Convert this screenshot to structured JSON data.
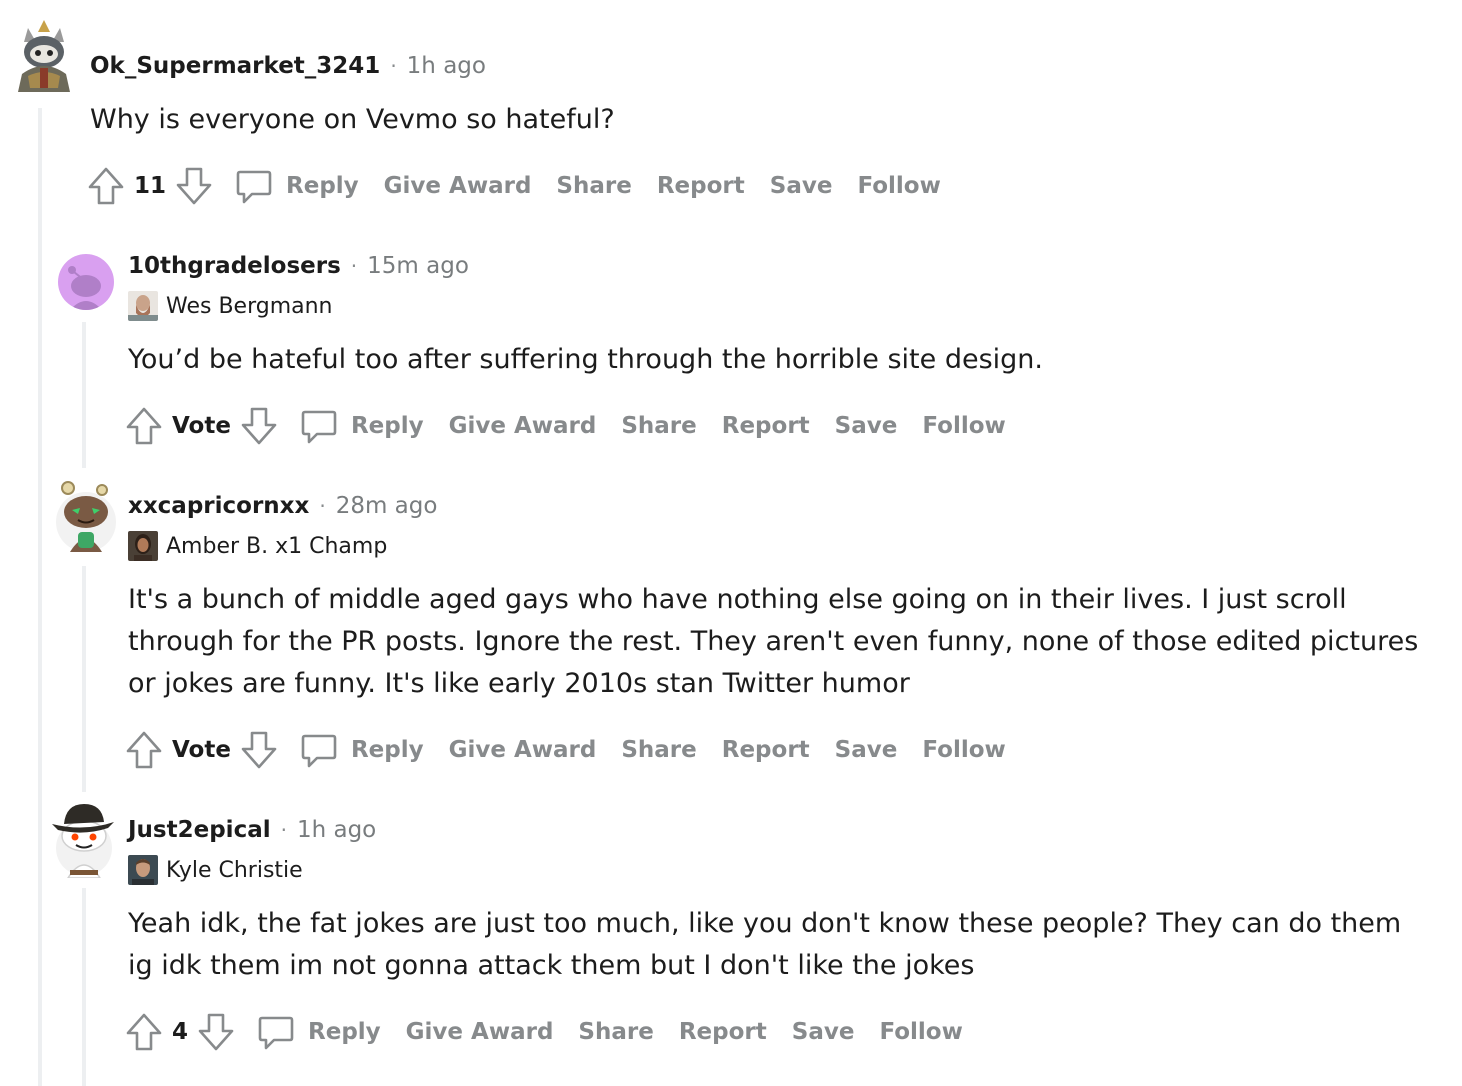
{
  "colors": {
    "meta": "#787c7e",
    "action": "#878a8c",
    "thread_line": "#edeff1",
    "text": "#1c1c1c"
  },
  "actions": {
    "reply": "Reply",
    "give_award": "Give Award",
    "share": "Share",
    "report": "Report",
    "save": "Save",
    "follow": "Follow"
  },
  "comments": [
    {
      "author": "Ok_Supermarket_3241",
      "time": "1h ago",
      "body": "Why is everyone on Vevmo so hateful?",
      "votes": "11",
      "avatar_icon": "armored-snoo-avatar-icon"
    },
    {
      "author": "10thgradelosers",
      "time": "15m ago",
      "flair": "Wes Bergmann",
      "body": "You’d be hateful too after suffering through the horrible site design.",
      "votes": "Vote",
      "avatar_icon": "default-snoo-avatar-icon"
    },
    {
      "author": "xxcapricornxx",
      "time": "28m ago",
      "flair": "Amber B. x1 Champ",
      "body": "It's a bunch of middle aged gays who have nothing else going on in their lives. I just scroll through for the PR posts. Ignore the rest. They aren't even funny, none of those edited pictures or jokes are funny. It's like early 2010s stan Twitter humor",
      "votes": "Vote",
      "avatar_icon": "green-snoo-avatar-icon"
    },
    {
      "author": "Just2epical",
      "time": "1h ago",
      "flair": "Kyle Christie",
      "body": "Yeah idk, the fat jokes are just too much, like you don't know these people? They can do them ig idk them im not gonna attack them but I don't like the jokes",
      "votes": "4",
      "avatar_icon": "cowboy-snoo-avatar-icon"
    }
  ]
}
